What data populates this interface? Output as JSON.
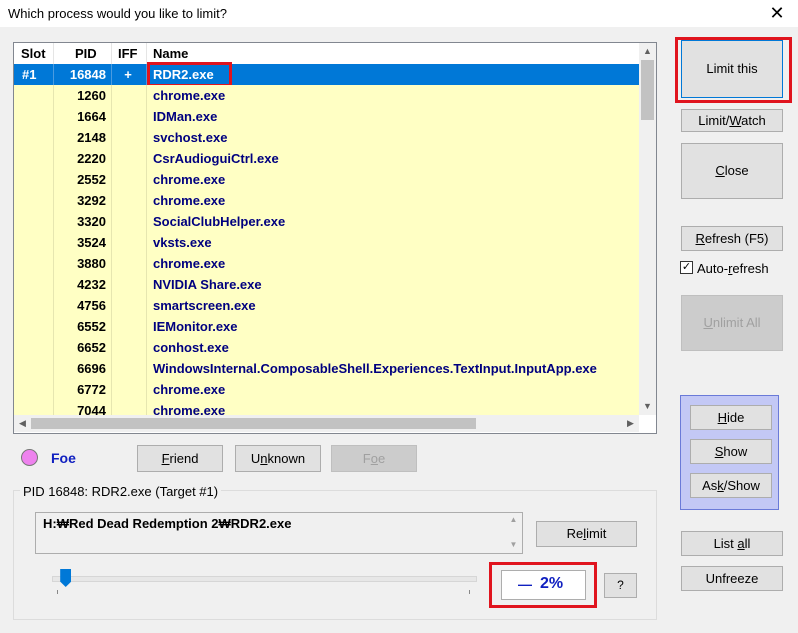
{
  "window": {
    "title": "Which process would you like to limit?",
    "close_glyph": "✕"
  },
  "columns": {
    "slot": "Slot",
    "pid": "PID",
    "iff": "IFF",
    "name": "Name"
  },
  "rows": [
    {
      "slot": "#1",
      "pid": "16848",
      "iff": "+",
      "name": "RDR2.exe",
      "selected": true
    },
    {
      "slot": "",
      "pid": "1260",
      "iff": "",
      "name": "chrome.exe"
    },
    {
      "slot": "",
      "pid": "1664",
      "iff": "",
      "name": "IDMan.exe"
    },
    {
      "slot": "",
      "pid": "2148",
      "iff": "",
      "name": "svchost.exe"
    },
    {
      "slot": "",
      "pid": "2220",
      "iff": "",
      "name": "CsrAudioguiCtrl.exe"
    },
    {
      "slot": "",
      "pid": "2552",
      "iff": "",
      "name": "chrome.exe"
    },
    {
      "slot": "",
      "pid": "3292",
      "iff": "",
      "name": "chrome.exe"
    },
    {
      "slot": "",
      "pid": "3320",
      "iff": "",
      "name": "SocialClubHelper.exe"
    },
    {
      "slot": "",
      "pid": "3524",
      "iff": "",
      "name": "vksts.exe"
    },
    {
      "slot": "",
      "pid": "3880",
      "iff": "",
      "name": "chrome.exe"
    },
    {
      "slot": "",
      "pid": "4232",
      "iff": "",
      "name": "NVIDIA Share.exe"
    },
    {
      "slot": "",
      "pid": "4756",
      "iff": "",
      "name": "smartscreen.exe"
    },
    {
      "slot": "",
      "pid": "6552",
      "iff": "",
      "name": "IEMonitor.exe"
    },
    {
      "slot": "",
      "pid": "6652",
      "iff": "",
      "name": "conhost.exe"
    },
    {
      "slot": "",
      "pid": "6696",
      "iff": "",
      "name": "WindowsInternal.ComposableShell.Experiences.TextInput.InputApp.exe"
    },
    {
      "slot": "",
      "pid": "6772",
      "iff": "",
      "name": "chrome.exe"
    },
    {
      "slot": "",
      "pid": "7044",
      "iff": "",
      "name": "chrome.exe"
    }
  ],
  "buttons": {
    "limit_this": "Limit this",
    "limit_watch_pre": "Limit/",
    "limit_watch_u": "W",
    "limit_watch_post": "atch",
    "close_u": "C",
    "close_post": "lose",
    "refresh_u": "R",
    "refresh_post": "efresh (F5)",
    "unlimit_all_u": "U",
    "unlimit_all_post": "nlimit All",
    "hide_u": "H",
    "hide_post": "ide",
    "show_u": "S",
    "show_post": "how",
    "ask_show_pre": "As",
    "ask_show_u": "k",
    "ask_show_post": "/Show",
    "list_all_pre": "List ",
    "list_all_u": "a",
    "list_all_post": "ll",
    "unfreeze": "Unfreeze",
    "friend_u": "F",
    "friend_post": "riend",
    "unknown_pre": "U",
    "unknown_u": "n",
    "unknown_post": "known",
    "foe_pre": "F",
    "foe_u": "o",
    "foe_post": "e",
    "relimit_pre": "Re",
    "relimit_u": "l",
    "relimit_post": "imit",
    "help": "?"
  },
  "auto_refresh": {
    "label_pre": "Auto-",
    "label_u": "r",
    "label_post": "efresh",
    "checked": true,
    "mark": "✓"
  },
  "iff_status": {
    "label": "Foe",
    "color": "#ee82ee"
  },
  "target": {
    "group_title": "PID 16848: RDR2.exe (Target #1)",
    "path": "H:₩Red Dead Redemption 2₩RDR2.exe",
    "dash": "—",
    "percent": "2%",
    "slider_fraction": 0.02
  }
}
